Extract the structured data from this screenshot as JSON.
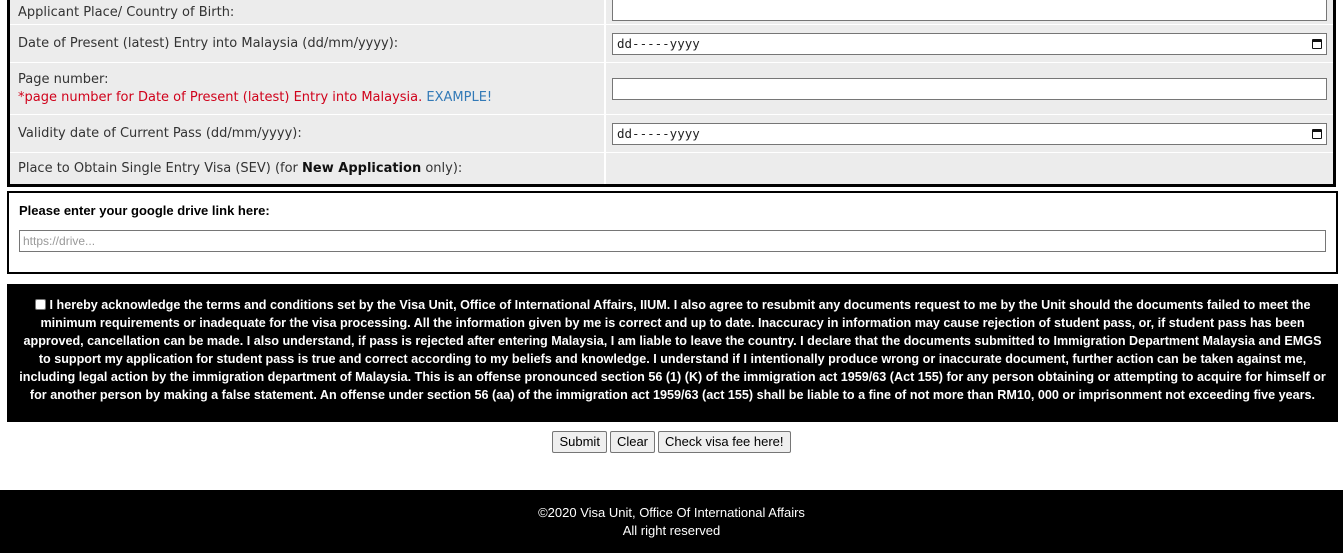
{
  "form": {
    "rows": [
      {
        "label": "Applicant Place/ Country of Birth:",
        "value": ""
      },
      {
        "label": "Date of Present (latest) Entry into Malaysia (dd/mm/yyyy):",
        "value": "dd-----yyyy"
      },
      {
        "label": "Page number:",
        "note": "*page number for Date of Present (latest) Entry into Malaysia.",
        "link": "EXAMPLE!",
        "value": ""
      },
      {
        "label": "Validity date of Current Pass (dd/mm/yyyy):",
        "value": "dd-----yyyy"
      },
      {
        "label_pre": "Place to Obtain Single Entry Visa (SEV) (for ",
        "label_bold": "New Application",
        "label_post": " only):"
      }
    ]
  },
  "drive": {
    "label": "Please enter your google drive link here:",
    "placeholder": "https://drive..."
  },
  "terms": {
    "text": "I hereby acknowledge the terms and conditions set by the Visa Unit, Office of International Affairs, IIUM. I also agree to resubmit any documents request to me by the Unit should the documents failed to meet the minimum requirements or inadequate for the visa processing. All the information given by me is correct and up to date. Inaccuracy in information may cause rejection of student pass, or, if student pass has been approved, cancellation can be made. I also understand, if pass is rejected after entering Malaysia, I am liable to leave the country. I declare that the documents submitted to Immigration Department Malaysia and EMGS to support my application for student pass is true and correct according to my beliefs and knowledge. I understand if I intentionally produce wrong or inaccurate document, further action can be taken against me, including legal action by the immigration department of Malaysia. This is an offense pronounced section 56 (1) (K) of the immigration act 1959/63 (Act 155) for any person obtaining or attempting to acquire for himself or for another person by making a false statement. An offense under section 56 (aa) of the immigration act 1959/63 (act 155) shall be liable to a fine of not more than RM10, 000 or imprisonment not exceeding five years.",
    "checked": false
  },
  "buttons": {
    "submit": "Submit",
    "clear": "Clear",
    "fee": "Check visa fee here!"
  },
  "footer": {
    "line1": "©2020 Visa Unit, Office Of International Affairs",
    "line2": "All right reserved"
  },
  "colors": {
    "note_red": "#d0021b",
    "link_blue": "#337ab7",
    "row_bg": "#ececec"
  }
}
